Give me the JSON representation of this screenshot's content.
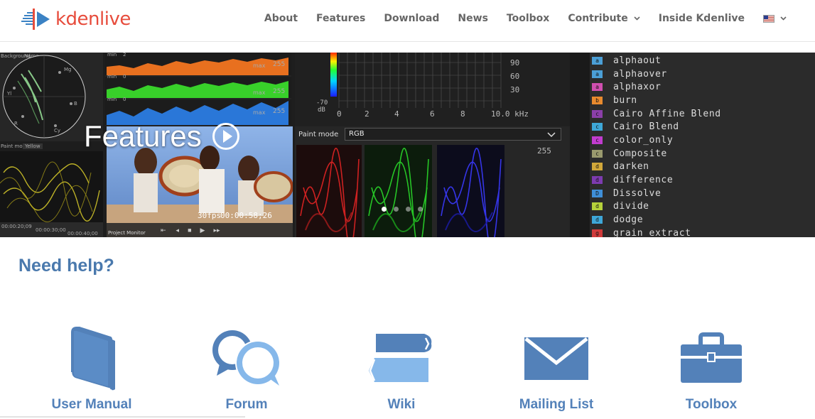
{
  "brand": {
    "name": "kdenlive",
    "logo_color": "#e74c3c",
    "icon_color": "#3b82c4"
  },
  "nav": {
    "items": [
      {
        "label": "About",
        "has_dropdown": false
      },
      {
        "label": "Features",
        "has_dropdown": false
      },
      {
        "label": "Download",
        "has_dropdown": false
      },
      {
        "label": "News",
        "has_dropdown": false
      },
      {
        "label": "Toolbox",
        "has_dropdown": false
      },
      {
        "label": "Contribute",
        "has_dropdown": true
      },
      {
        "label": "Inside Kdenlive",
        "has_dropdown": false
      }
    ],
    "language_icon": "us-flag-icon"
  },
  "hero": {
    "title": "Features",
    "play_icon": "play-circle-icon",
    "slides_total": 4,
    "active_slide": 1,
    "screenshot": {
      "scope_labels": {
        "background": "Background",
        "name": "Name",
        "mg": "Mg",
        "b": "B",
        "cy": "Cy",
        "yl": "Yl",
        "r": "R",
        "paint_mode": "Paint mode",
        "yellow": "Yellow",
        "max": "max",
        "min": "min",
        "hist_max": "255",
        "hist_min": "0",
        "hist_min2": "2"
      },
      "timecodes": {
        "t1": "00:00:20;09",
        "t2": "00:00:30;00",
        "t3": "00:00:40;00",
        "fps": "30fps",
        "clip_time": "00:00:58;26",
        "project_monitor": "Project Monitor"
      },
      "audio_spectrum": {
        "db_values": [
          "90",
          "60",
          "30"
        ],
        "db_bottom": "-70",
        "db_unit": "dB",
        "freq_ticks": [
          "0",
          "2",
          "4",
          "6",
          "8",
          "10.0 kHz"
        ]
      },
      "rgb_parade": {
        "paint_mode_label": "Paint mode",
        "paint_mode_value": "RGB",
        "max_value": "255"
      },
      "blend_modes": [
        {
          "badge": "a",
          "name": "alphaout",
          "color": "#4b9fd6"
        },
        {
          "badge": "a",
          "name": "alphaover",
          "color": "#4b9fd6"
        },
        {
          "badge": "a",
          "name": "alphaxor",
          "color": "#d04fb0"
        },
        {
          "badge": "b",
          "name": "burn",
          "color": "#e88a2e"
        },
        {
          "badge": "c",
          "name": "Cairo Affine Blend",
          "color": "#8b3fa8"
        },
        {
          "badge": "c",
          "name": "Cairo Blend",
          "color": "#3ea7d8"
        },
        {
          "badge": "c",
          "name": "color_only",
          "color": "#c13ccf"
        },
        {
          "badge": "c",
          "name": "Composite",
          "color": "#9a9a6e"
        },
        {
          "badge": "d",
          "name": "darken",
          "color": "#d2a83a"
        },
        {
          "badge": "d",
          "name": "difference",
          "color": "#7d3bb0"
        },
        {
          "badge": "D",
          "name": "Dissolve",
          "color": "#3f8fd8"
        },
        {
          "badge": "d",
          "name": "divide",
          "color": "#b6d23b"
        },
        {
          "badge": "d",
          "name": "dodge",
          "color": "#3ea7d8"
        },
        {
          "badge": "g",
          "name": "grain_extract",
          "color": "#d03a3a"
        }
      ]
    }
  },
  "help": {
    "title": "Need help?",
    "items": [
      {
        "label": "User Manual",
        "icon": "book-icon"
      },
      {
        "label": "Forum",
        "icon": "chat-bubbles-icon"
      },
      {
        "label": "Wiki",
        "icon": "scroll-icon"
      },
      {
        "label": "Mailing List",
        "icon": "envelope-icon"
      },
      {
        "label": "Toolbox",
        "icon": "toolbox-icon"
      }
    ],
    "icon_color": "#5381b9"
  }
}
